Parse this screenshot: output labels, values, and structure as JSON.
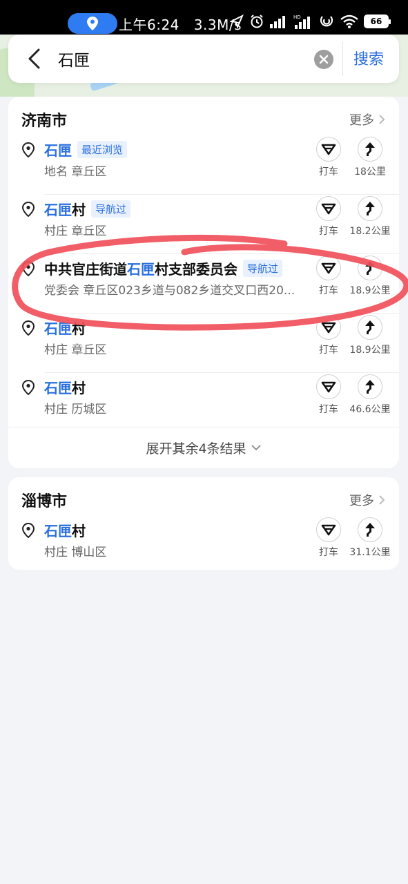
{
  "status_bar": {
    "time": "上午6:24",
    "speed": "3.3M/s",
    "battery": "66",
    "icons": [
      "location-icon",
      "send-icon",
      "alarm-icon",
      "signal-icon",
      "hd-signal-icon",
      "hotspot-icon",
      "wifi-icon",
      "battery-icon"
    ]
  },
  "search": {
    "query": "石匣",
    "button_label": "搜索",
    "icons": [
      "back-icon",
      "clear-icon"
    ]
  },
  "sections": [
    {
      "city": "济南市",
      "more_label": "更多",
      "items": [
        {
          "title_prefix": "",
          "title_highlight": "石匣",
          "title_suffix": "",
          "tag": "最近浏览",
          "subtitle": "地名 章丘区",
          "taxi_label": "打车",
          "distance": "18公里"
        },
        {
          "title_prefix": "",
          "title_highlight": "石匣",
          "title_suffix": "村",
          "tag": "导航过",
          "subtitle": "村庄 章丘区",
          "taxi_label": "打车",
          "distance": "18.2公里"
        },
        {
          "title_prefix": "中共官庄街道",
          "title_highlight": "石匣",
          "title_suffix": "村支部委员会",
          "tag": "导航过",
          "subtitle": "党委会 章丘区023乡道与082乡道交叉口西20...",
          "taxi_label": "打车",
          "distance": "18.9公里"
        },
        {
          "title_prefix": "",
          "title_highlight": "石匣",
          "title_suffix": "村",
          "tag": "",
          "subtitle": "村庄 章丘区",
          "taxi_label": "打车",
          "distance": "18.9公里"
        },
        {
          "title_prefix": "",
          "title_highlight": "石匣",
          "title_suffix": "村",
          "tag": "",
          "subtitle": "村庄 历城区",
          "taxi_label": "打车",
          "distance": "46.6公里"
        }
      ],
      "expand_label": "展开其余4条结果"
    },
    {
      "city": "淄博市",
      "more_label": "更多",
      "items": [
        {
          "title_prefix": "",
          "title_highlight": "石匣",
          "title_suffix": "村",
          "tag": "",
          "subtitle": "村庄 博山区",
          "taxi_label": "打车",
          "distance": "31.1公里"
        }
      ]
    }
  ],
  "colors": {
    "accent": "#2a6fde",
    "tag_bg": "#e8f1fd",
    "annotation": "#f0505a",
    "page_bg": "#f3f4f7"
  }
}
